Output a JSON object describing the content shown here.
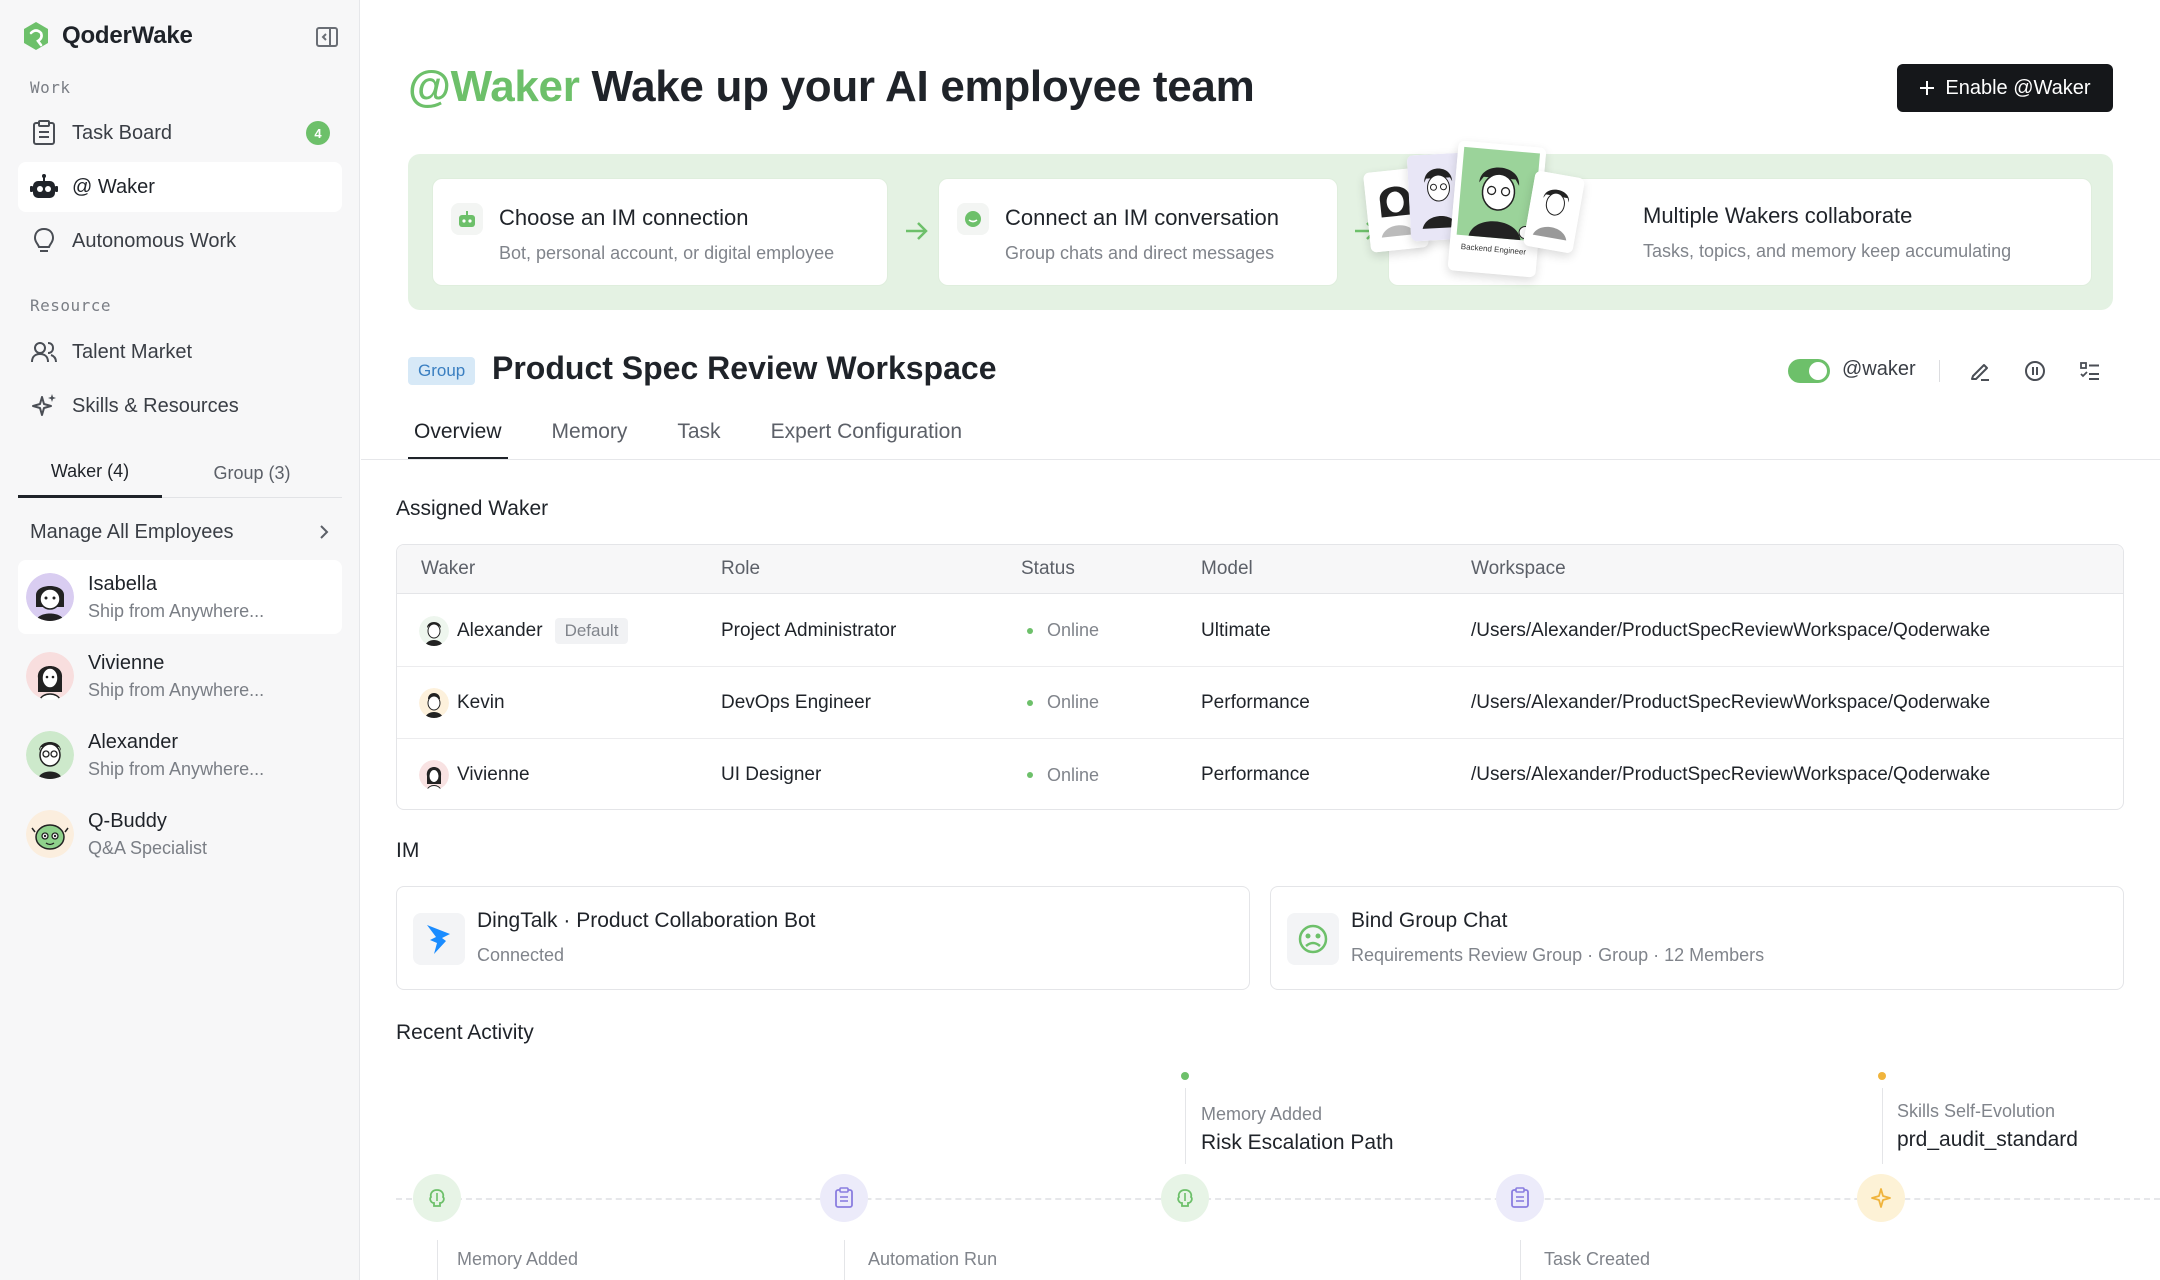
{
  "brand": {
    "name": "QoderWake"
  },
  "sidebar": {
    "section_work": "Work",
    "section_resource": "Resource",
    "nav_task_board": "Task Board",
    "task_badge": "4",
    "nav_waker": "@ Waker",
    "nav_autonomous": "Autonomous Work",
    "nav_talent": "Talent Market",
    "nav_skills": "Skills & Resources",
    "tab_waker": "Waker (4)",
    "tab_group": "Group (3)",
    "manage_all": "Manage All Employees",
    "employees": [
      {
        "name": "Isabella",
        "sub": "Ship from Anywhere..."
      },
      {
        "name": "Vivienne",
        "sub": "Ship from Anywhere..."
      },
      {
        "name": "Alexander",
        "sub": "Ship from Anywhere..."
      },
      {
        "name": "Q-Buddy",
        "sub": "Q&A Specialist"
      }
    ]
  },
  "hero": {
    "accent": "@Waker",
    "title": "Wake up your AI employee team",
    "enable_button": "Enable @Waker"
  },
  "flow": {
    "step1": {
      "title": "Choose an IM connection",
      "sub": "Bot, personal account, or digital employee"
    },
    "step2": {
      "title": "Connect an IM conversation",
      "sub": "Group chats and direct messages"
    },
    "step3": {
      "title": "Multiple Wakers collaborate",
      "sub": "Tasks, topics, and memory keep accumulating"
    },
    "portrait_labels": [
      "Backend Engineer"
    ]
  },
  "workspace": {
    "tag": "Group",
    "title": "Product Spec Review Workspace",
    "toggle_label": "@waker",
    "toggle_on": true
  },
  "tabs": [
    "Overview",
    "Memory",
    "Task",
    "Expert Configuration"
  ],
  "assigned": {
    "title": "Assigned Waker",
    "headers": [
      "Waker",
      "Role",
      "Status",
      "Model",
      "Workspace"
    ],
    "default_tag": "Default",
    "rows": [
      {
        "waker": "Alexander",
        "role": "Project Administrator",
        "status": "Online",
        "model": "Ultimate",
        "workspace": "/Users/Alexander/ProductSpecReviewWorkspace/Qoderwake"
      },
      {
        "waker": "Kevin",
        "role": "DevOps Engineer",
        "status": "Online",
        "model": "Performance",
        "workspace": "/Users/Alexander/ProductSpecReviewWorkspace/Qoderwake"
      },
      {
        "waker": "Vivienne",
        "role": "UI Designer",
        "status": "Online",
        "model": "Performance",
        "workspace": "/Users/Alexander/ProductSpecReviewWorkspace/Qoderwake"
      }
    ]
  },
  "im": {
    "title": "IM",
    "card1": {
      "title": "DingTalk · Product Collaboration Bot",
      "sub": "Connected"
    },
    "card2": {
      "title": "Bind Group Chat",
      "sub": "Requirements Review Group  ·  Group · 12 Members"
    }
  },
  "activity": {
    "title": "Recent Activity",
    "top1": {
      "label": "Memory Added",
      "text": "Risk Escalation Path"
    },
    "top2": {
      "label": "Skills Self-Evolution",
      "text": "prd_audit_standard"
    },
    "bottom1": {
      "label": "Memory Added"
    },
    "bottom2": {
      "label": "Automation Run"
    },
    "bottom3": {
      "label": "Task Created"
    }
  },
  "colors": {
    "accent_green": "#6dc06a",
    "dark_button": "#15171a",
    "flow_panel": "#e4f2e3",
    "tag_blue": "#3a7fc1",
    "timeline_purple": "#8a7ee0",
    "timeline_orange": "#f0b43c"
  }
}
